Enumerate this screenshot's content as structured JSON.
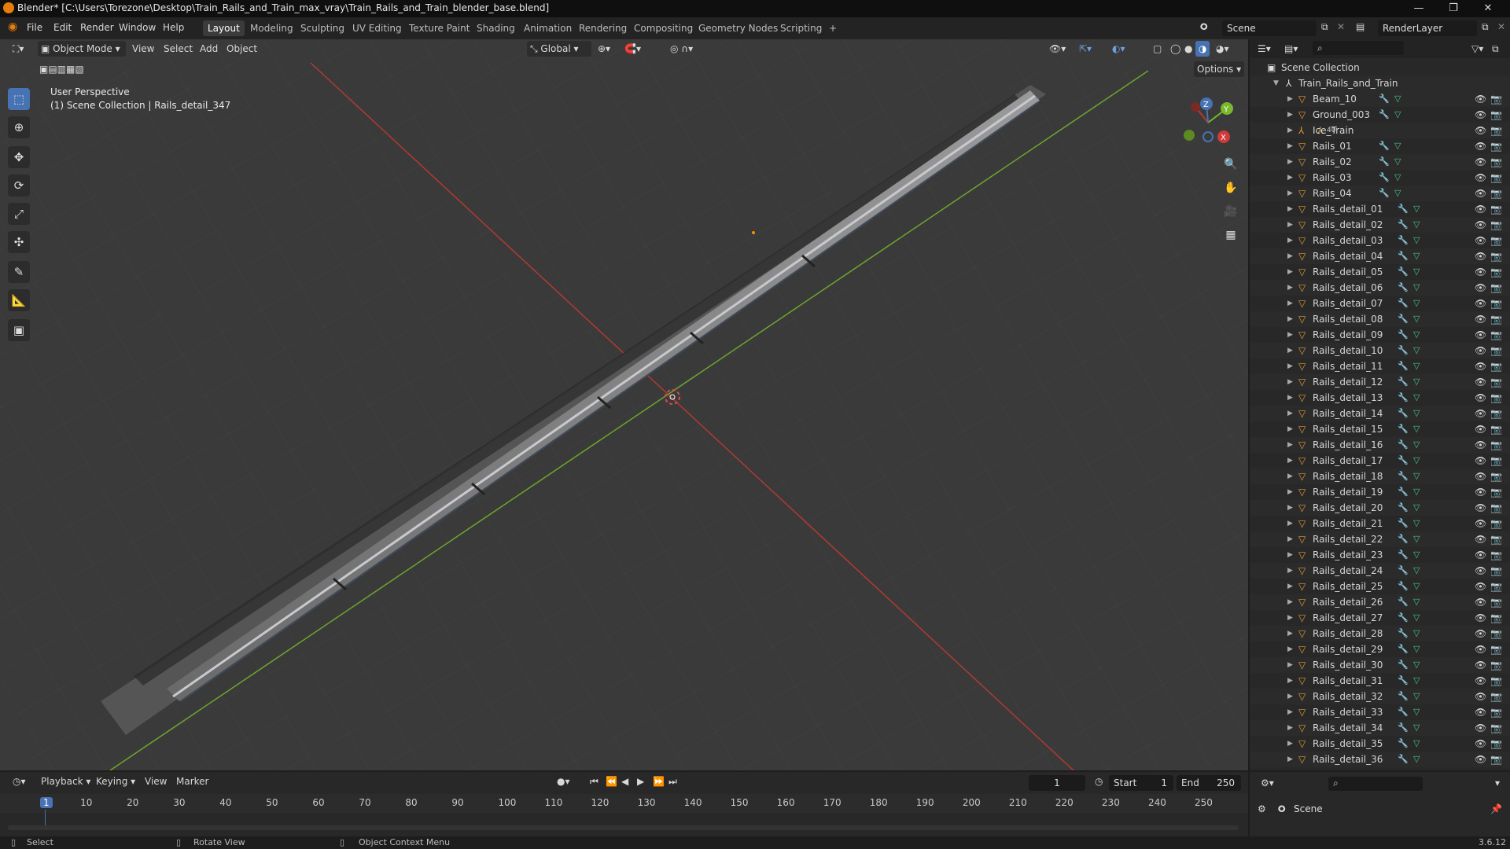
{
  "window": {
    "title": "Blender* [C:\\Users\\Torezone\\Desktop\\Train_Rails_and_Train_max_vray\\Train_Rails_and_Train_blender_base.blend]",
    "controls": [
      "—",
      "❐",
      "✕"
    ]
  },
  "menu": [
    "File",
    "Edit",
    "Render",
    "Window",
    "Help"
  ],
  "workspaces": [
    "Layout",
    "Modeling",
    "Sculpting",
    "UV Editing",
    "Texture Paint",
    "Shading",
    "Animation",
    "Rendering",
    "Compositing",
    "Geometry Nodes",
    "Scripting",
    "+"
  ],
  "active_workspace": "Layout",
  "scene_field": "Scene",
  "render_layer_field": "RenderLayer",
  "viewport": {
    "mode": "Object Mode",
    "menus": [
      "View",
      "Select",
      "Add",
      "Object"
    ],
    "transform_orientation": "Global",
    "options_label": "Options",
    "overlay_line1": "User Perspective",
    "overlay_line2": "(1) Scene Collection | Rails_detail_347",
    "tools": [
      "select-box-icon",
      "cursor-icon",
      "move-icon",
      "rotate-icon",
      "scale-icon",
      "transform-icon",
      "annotate-icon",
      "measure-icon",
      "add-cube-icon"
    ],
    "gizmo_axes": [
      "X",
      "Y",
      "Z"
    ],
    "grid_color": "#434343",
    "x_axis_color": "#c0392b",
    "y_axis_color": "#7ab82c"
  },
  "outliner": {
    "root": "Scene Collection",
    "collection": "Train_Rails_and_Train",
    "items": [
      "Beam_10",
      "Ground_003",
      "Ice_Train",
      "Rails_01",
      "Rails_02",
      "Rails_03",
      "Rails_04",
      "Rails_detail_01",
      "Rails_detail_02",
      "Rails_detail_03",
      "Rails_detail_04",
      "Rails_detail_05",
      "Rails_detail_06",
      "Rails_detail_07",
      "Rails_detail_08",
      "Rails_detail_09",
      "Rails_detail_10",
      "Rails_detail_11",
      "Rails_detail_12",
      "Rails_detail_13",
      "Rails_detail_14",
      "Rails_detail_15",
      "Rails_detail_16",
      "Rails_detail_17",
      "Rails_detail_18",
      "Rails_detail_19",
      "Rails_detail_20",
      "Rails_detail_21",
      "Rails_detail_22",
      "Rails_detail_23",
      "Rails_detail_24",
      "Rails_detail_25",
      "Rails_detail_26",
      "Rails_detail_27",
      "Rails_detail_28",
      "Rails_detail_29",
      "Rails_detail_30",
      "Rails_detail_31",
      "Rails_detail_32",
      "Rails_detail_33",
      "Rails_detail_34",
      "Rails_detail_35",
      "Rails_detail_36"
    ],
    "ice_train_badge": "40"
  },
  "timeline": {
    "menus": [
      "Playback",
      "Keying",
      "View",
      "Marker"
    ],
    "current_frame": "1",
    "start_label": "Start",
    "start_value": "1",
    "end_label": "End",
    "end_value": "250",
    "ticks": [
      "1",
      "10",
      "20",
      "30",
      "40",
      "50",
      "60",
      "70",
      "80",
      "90",
      "100",
      "110",
      "120",
      "130",
      "140",
      "150",
      "160",
      "170",
      "180",
      "190",
      "200",
      "210",
      "220",
      "230",
      "240",
      "250"
    ]
  },
  "properties": {
    "scene_label": "Scene"
  },
  "status": {
    "select": "Select",
    "rotate": "Rotate View",
    "context": "Object Context Menu",
    "version": "3.6.12"
  }
}
